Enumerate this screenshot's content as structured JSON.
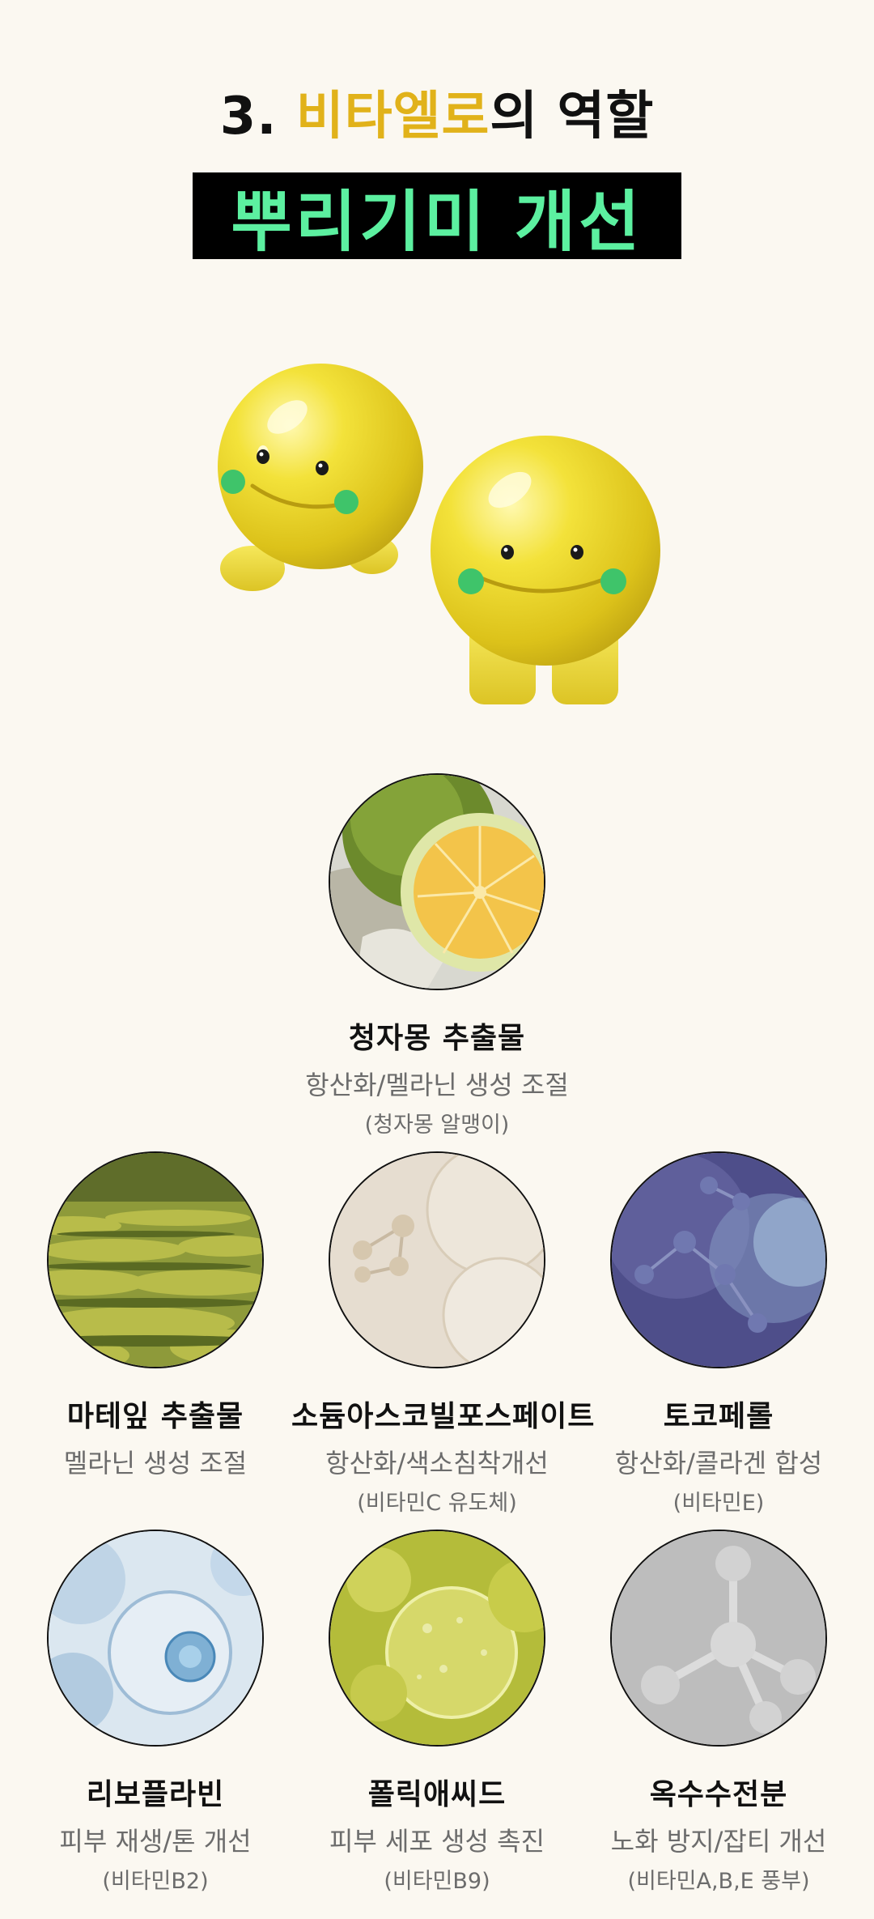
{
  "header": {
    "number": "3.",
    "accent": "비타엘로",
    "rest": "의 역할",
    "banner": "뿌리기미 개선"
  },
  "colors": {
    "accent": "#e1b21a",
    "banner_text": "#5cf0a0",
    "background": "#fbf8f1"
  },
  "ingredients": [
    {
      "name": "청자몽 추출물",
      "desc": "항산화/멜라닌 생성 조절",
      "note": "(청자몽 알맹이)",
      "image": "grapefruit-photo"
    },
    {
      "name": "마테잎 추출물",
      "desc": "멜라닌 생성 조절",
      "note": "",
      "image": "tea-field-photo"
    },
    {
      "name": "소듐아스코빌포스페이트",
      "desc": "항산화/색소침착개선",
      "note": "(비타민C 유도체)",
      "image": "molecule-beige-photo"
    },
    {
      "name": "토코페롤",
      "desc": "항산화/콜라겐 합성",
      "note": "(비타민E)",
      "image": "molecule-purple-photo"
    },
    {
      "name": "리보플라빈",
      "desc": "피부 재생/톤 개선",
      "note": "(비타민B2)",
      "image": "cell-blue-photo"
    },
    {
      "name": "폴릭애씨드",
      "desc": "피부 세포 생성 촉진",
      "note": "(비타민B9)",
      "image": "bubbles-green-photo"
    },
    {
      "name": "옥수수전분",
      "desc": "노화 방지/잡티 개선",
      "note": "(비타민A,B,E 풍부)",
      "image": "molecule-gray-photo"
    }
  ]
}
